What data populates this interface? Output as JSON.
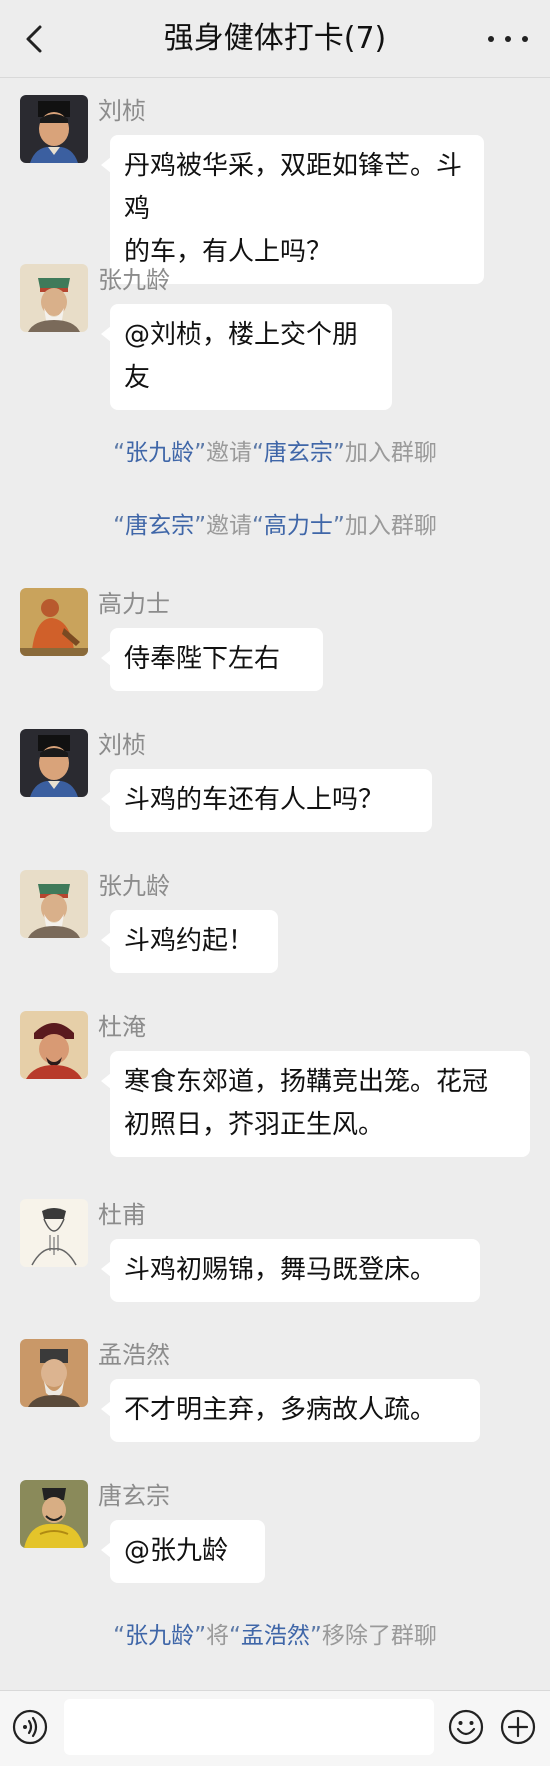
{
  "header": {
    "title": "强身健体打卡(7)",
    "back_icon": "chevron-left-icon",
    "more_icon": "more-dots-icon"
  },
  "messages": [
    {
      "sender": "刘桢",
      "text": "丹鸡被华采，双距如锋芒。斗鸡\n的车，有人上吗？"
    },
    {
      "sender": "张九龄",
      "text": "@刘桢，楼上交个朋友"
    },
    {
      "sender": "高力士",
      "text": "侍奉陛下左右"
    },
    {
      "sender": "刘桢",
      "text": "斗鸡的车还有人上吗？"
    },
    {
      "sender": "张九龄",
      "text": "斗鸡约起！"
    },
    {
      "sender": "杜淹",
      "text": "寒食东郊道，扬鞲竞出笼。花冠\n初照日，芥羽正生风。"
    },
    {
      "sender": "杜甫",
      "text": "斗鸡初赐锦，舞马既登床。"
    },
    {
      "sender": "孟浩然",
      "text": "不才明主弃，多病故人疏。"
    },
    {
      "sender": "唐玄宗",
      "text": "@张九龄"
    }
  ],
  "system": [
    {
      "a": "张九龄",
      "verb": "邀请",
      "b": "唐玄宗",
      "tail": "加入群聊"
    },
    {
      "a": "唐玄宗",
      "verb": "邀请",
      "b": "高力士",
      "tail": "加入群聊"
    },
    {
      "a": "张九龄",
      "verb": "将",
      "b": "孟浩然",
      "tail": "移除了群聊"
    }
  ],
  "quotes": {
    "open": "“",
    "close": "”"
  },
  "bottom_bar": {
    "voice_icon": "voice-icon",
    "emoji_icon": "emoji-icon",
    "plus_icon": "plus-icon",
    "input_value": ""
  },
  "colors": {
    "background": "#ededed",
    "bubble": "#ffffff",
    "name": "#8c8c8c",
    "system_text": "#9a9a9a",
    "system_highlight": "#3f66a8"
  }
}
